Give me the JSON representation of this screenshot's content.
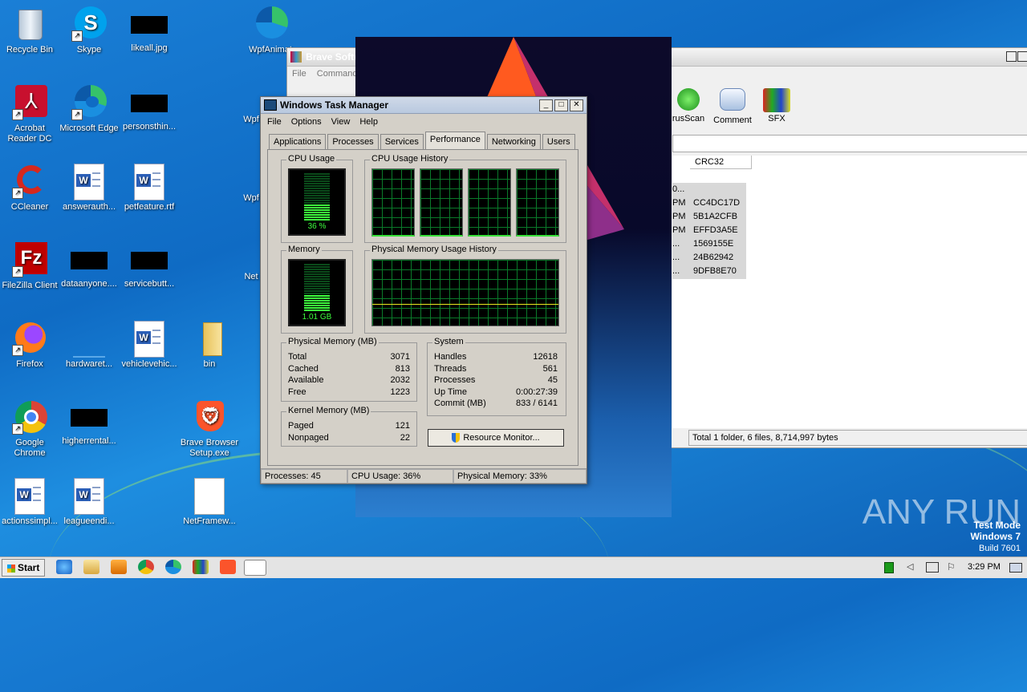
{
  "desktop": {
    "icons": [
      {
        "label": "Recycle Bin"
      },
      {
        "label": "Skype"
      },
      {
        "label": "likeall.jpg"
      },
      {
        "label": "WpfAnimat"
      },
      {
        "label": "Acrobat Reader DC"
      },
      {
        "label": "Microsoft Edge"
      },
      {
        "label": "personsthin..."
      },
      {
        "label": "Wpf"
      },
      {
        "label": "CCleaner"
      },
      {
        "label": "answerauth..."
      },
      {
        "label": "petfeature.rtf"
      },
      {
        "label": "Wpf"
      },
      {
        "label": "FileZilla Client"
      },
      {
        "label": "dataanyone...."
      },
      {
        "label": "servicebutt..."
      },
      {
        "label": "Net"
      },
      {
        "label": "Firefox"
      },
      {
        "label": "hardwaret..."
      },
      {
        "label": "vehiclevehic..."
      },
      {
        "label": "bin"
      },
      {
        "label": "Google Chrome"
      },
      {
        "label": "higherrental..."
      },
      {
        "label": "Brave Browser Setup.exe"
      },
      {
        "label": "actionssimpl..."
      },
      {
        "label": "leagueendi..."
      },
      {
        "label": "NetFramew..."
      }
    ]
  },
  "bg_window": {
    "title": "Brave Softw",
    "menu": [
      "File",
      "Commands"
    ],
    "toolbar": [
      {
        "label": "rusScan"
      },
      {
        "label": "Comment"
      },
      {
        "label": "SFX"
      }
    ],
    "column": "CRC32",
    "rows": [
      {
        "time": "0...",
        "crc": ""
      },
      {
        "time": "PM",
        "crc": "CC4DC17D"
      },
      {
        "time": "PM",
        "crc": "5B1A2CFB"
      },
      {
        "time": "PM",
        "crc": "EFFD3A5E"
      },
      {
        "time": "...",
        "crc": "1569155E"
      },
      {
        "time": "...",
        "crc": "24B62942"
      },
      {
        "time": "...",
        "crc": "9DFB8E70"
      }
    ],
    "status": "Total 1 folder, 6 files, 8,714,997 bytes"
  },
  "taskmgr": {
    "title": "Windows Task Manager",
    "menu": [
      "File",
      "Options",
      "View",
      "Help"
    ],
    "tabs": [
      "Applications",
      "Processes",
      "Services",
      "Performance",
      "Networking",
      "Users"
    ],
    "active_tab": "Performance",
    "cpu_usage_label": "CPU Usage",
    "cpu_value": "36 %",
    "cpu_fraction": 0.36,
    "cpu_history_label": "CPU Usage History",
    "memory_label": "Memory",
    "memory_value": "1.01 GB",
    "memory_fraction": 0.33,
    "phys_history_label": "Physical Memory Usage History",
    "physical_memory": {
      "heading": "Physical Memory (MB)",
      "rows": [
        {
          "k": "Total",
          "v": "3071"
        },
        {
          "k": "Cached",
          "v": "813"
        },
        {
          "k": "Available",
          "v": "2032"
        },
        {
          "k": "Free",
          "v": "1223"
        }
      ]
    },
    "kernel_memory": {
      "heading": "Kernel Memory (MB)",
      "rows": [
        {
          "k": "Paged",
          "v": "121"
        },
        {
          "k": "Nonpaged",
          "v": "22"
        }
      ]
    },
    "system": {
      "heading": "System",
      "rows": [
        {
          "k": "Handles",
          "v": "12618"
        },
        {
          "k": "Threads",
          "v": "561"
        },
        {
          "k": "Processes",
          "v": "45"
        },
        {
          "k": "Up Time",
          "v": "0:00:27:39"
        },
        {
          "k": "Commit (MB)",
          "v": "833 / 6141"
        }
      ]
    },
    "resource_monitor": "Resource Monitor...",
    "status": {
      "processes": "Processes: 45",
      "cpu": "CPU Usage: 36%",
      "memory": "Physical Memory: 33%"
    }
  },
  "taskbar": {
    "start": "Start",
    "time": "3:29 PM"
  },
  "watermark": {
    "brand": "ANY RUN",
    "mode": "Test Mode",
    "os": "Windows 7",
    "build": "Build 7601"
  }
}
